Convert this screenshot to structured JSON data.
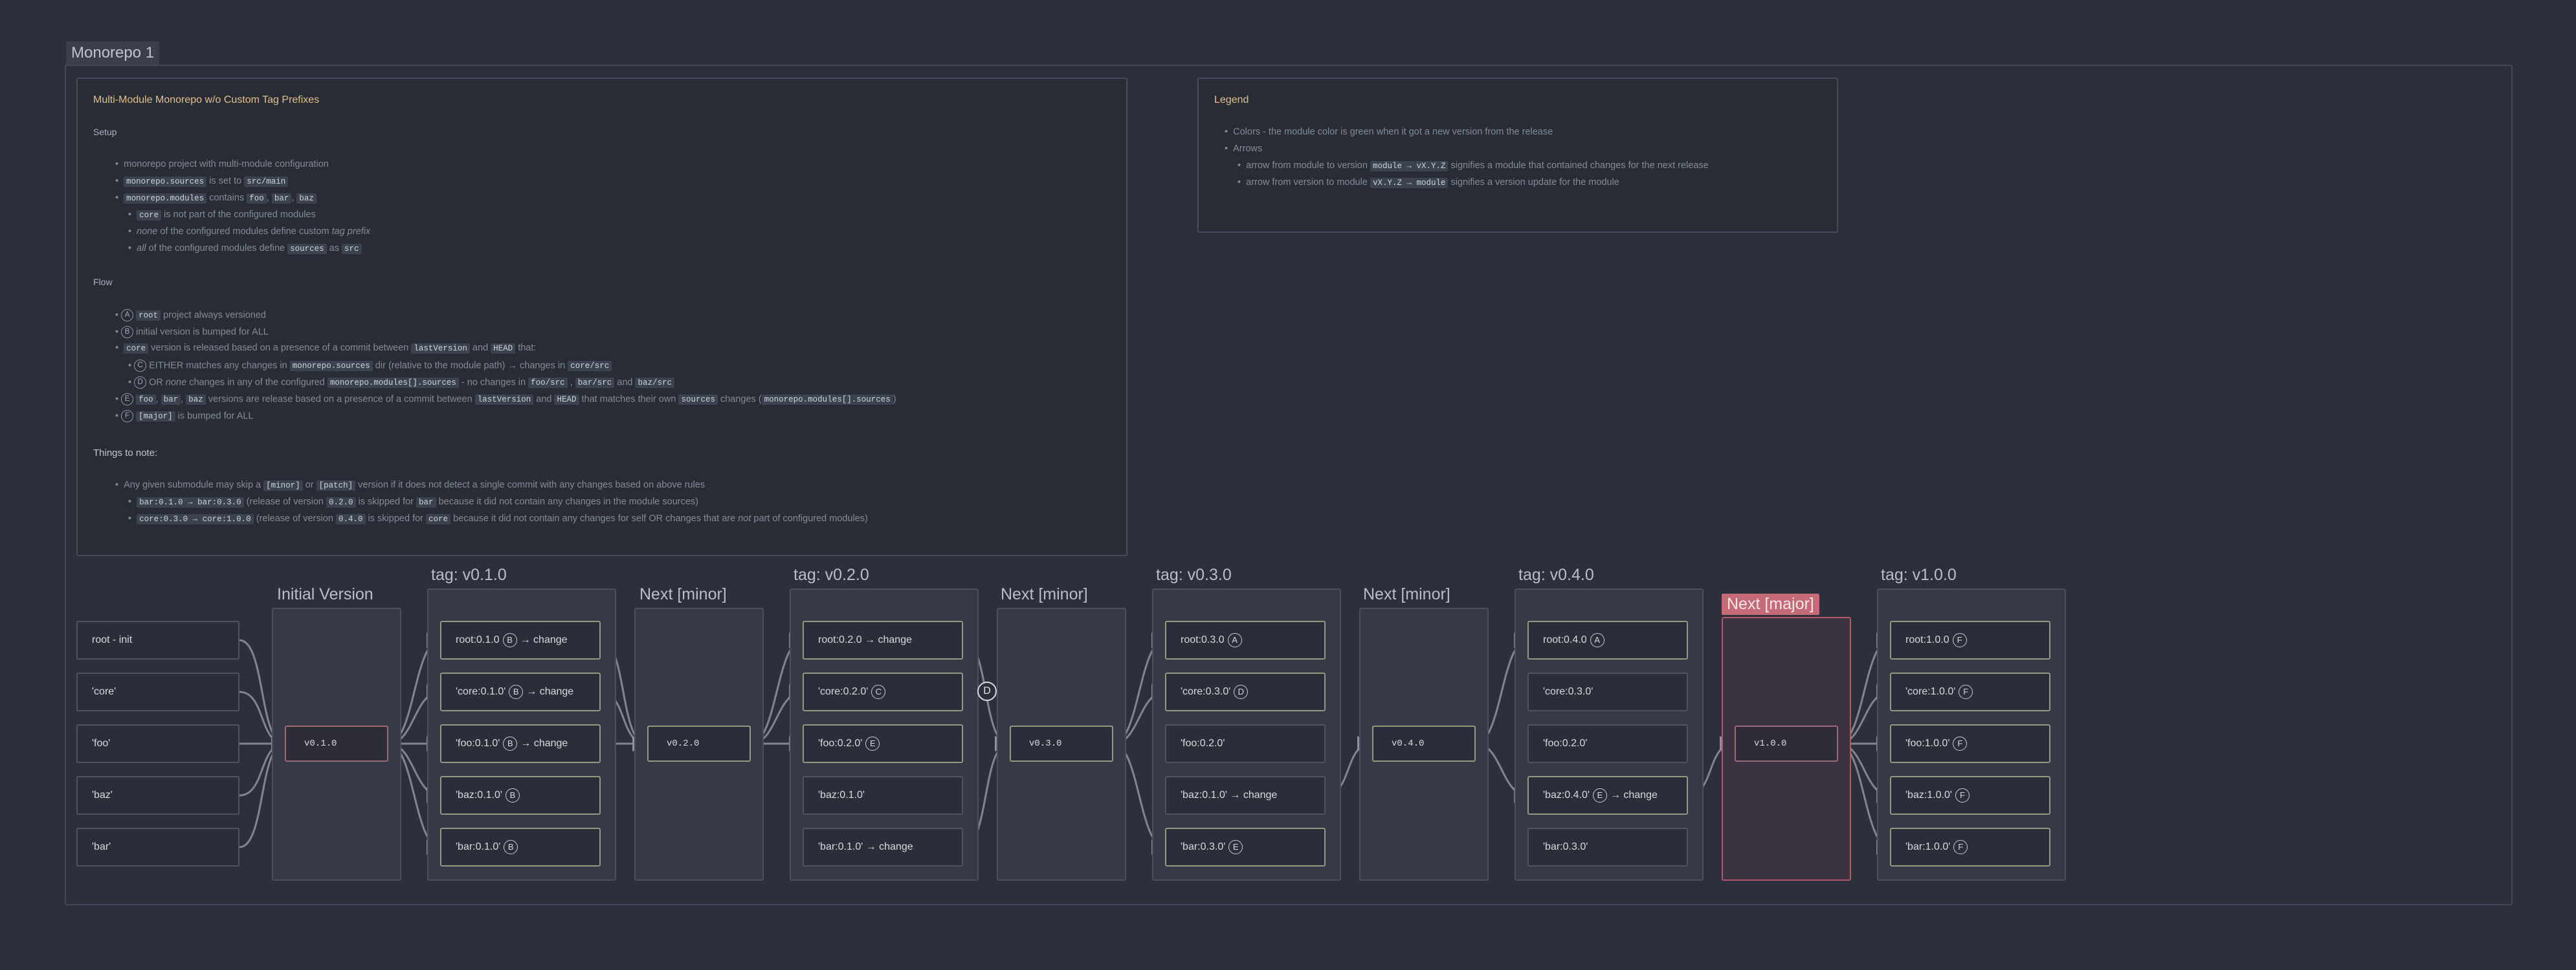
{
  "board_title": "Monorepo 1",
  "card": {
    "title": "Multi-Module Monorepo w/o Custom Tag Prefixes",
    "setup_heading": "Setup",
    "flow_heading": "Flow",
    "notes_heading": "Things to note:"
  },
  "legend": {
    "title": "Legend",
    "colors_text": "Colors - the module color is green when it got a new version from the release",
    "arrows_text": "Arrows",
    "arrow1": "arrow from module to version",
    "arrow1_code": "module → vX.Y.Z",
    "arrow1_tail": "signifies a module that contained changes for the next release",
    "arrow2": "arrow from version to module",
    "arrow2_code": "vX.Y.Z → module",
    "arrow2_tail": "signifies a version update for the module"
  },
  "columns": {
    "initial": "Initial Version",
    "t010": "tag: v0.1.0",
    "next1": "Next [minor]",
    "t020": "tag: v0.2.0",
    "next2": "Next [minor]",
    "t030": "tag: v0.3.0",
    "next3": "Next [minor]",
    "t040": "tag: v0.4.0",
    "next4": "Next [major]",
    "t100": "tag: v1.0.0"
  },
  "modules": [
    "root - init",
    "'core'",
    "'foo'",
    "'baz'",
    "'bar'"
  ],
  "versions": [
    "v0.1.0",
    "v0.2.0",
    "v0.3.0",
    "v0.4.0",
    "v1.0.0"
  ],
  "t010": [
    "root:0.1.0",
    "'core:0.1.0'",
    "'foo:0.1.0'",
    "'baz:0.1.0'",
    "'bar:0.1.0'"
  ],
  "t020": [
    "root:0.2.0 → change",
    "'core:0.2.0'",
    "'foo:0.2.0'",
    "'baz:0.1.0'",
    "'bar:0.1.0' → change"
  ],
  "t030": [
    "root:0.3.0",
    "'core:0.3.0'",
    "'foo:0.2.0'",
    "'baz:0.1.0' → change",
    "'bar:0.3.0'"
  ],
  "t040": [
    "root:0.4.0",
    "'core:0.3.0'",
    "'foo:0.2.0'",
    "'baz:0.4.0'",
    "'bar:0.3.0'"
  ],
  "t100": [
    "root:1.0.0",
    "'core:1.0.0'",
    "'foo:1.0.0'",
    "'baz:1.0.0'",
    "'bar:1.0.0'"
  ],
  "change": "→ change",
  "d_marker": "D"
}
